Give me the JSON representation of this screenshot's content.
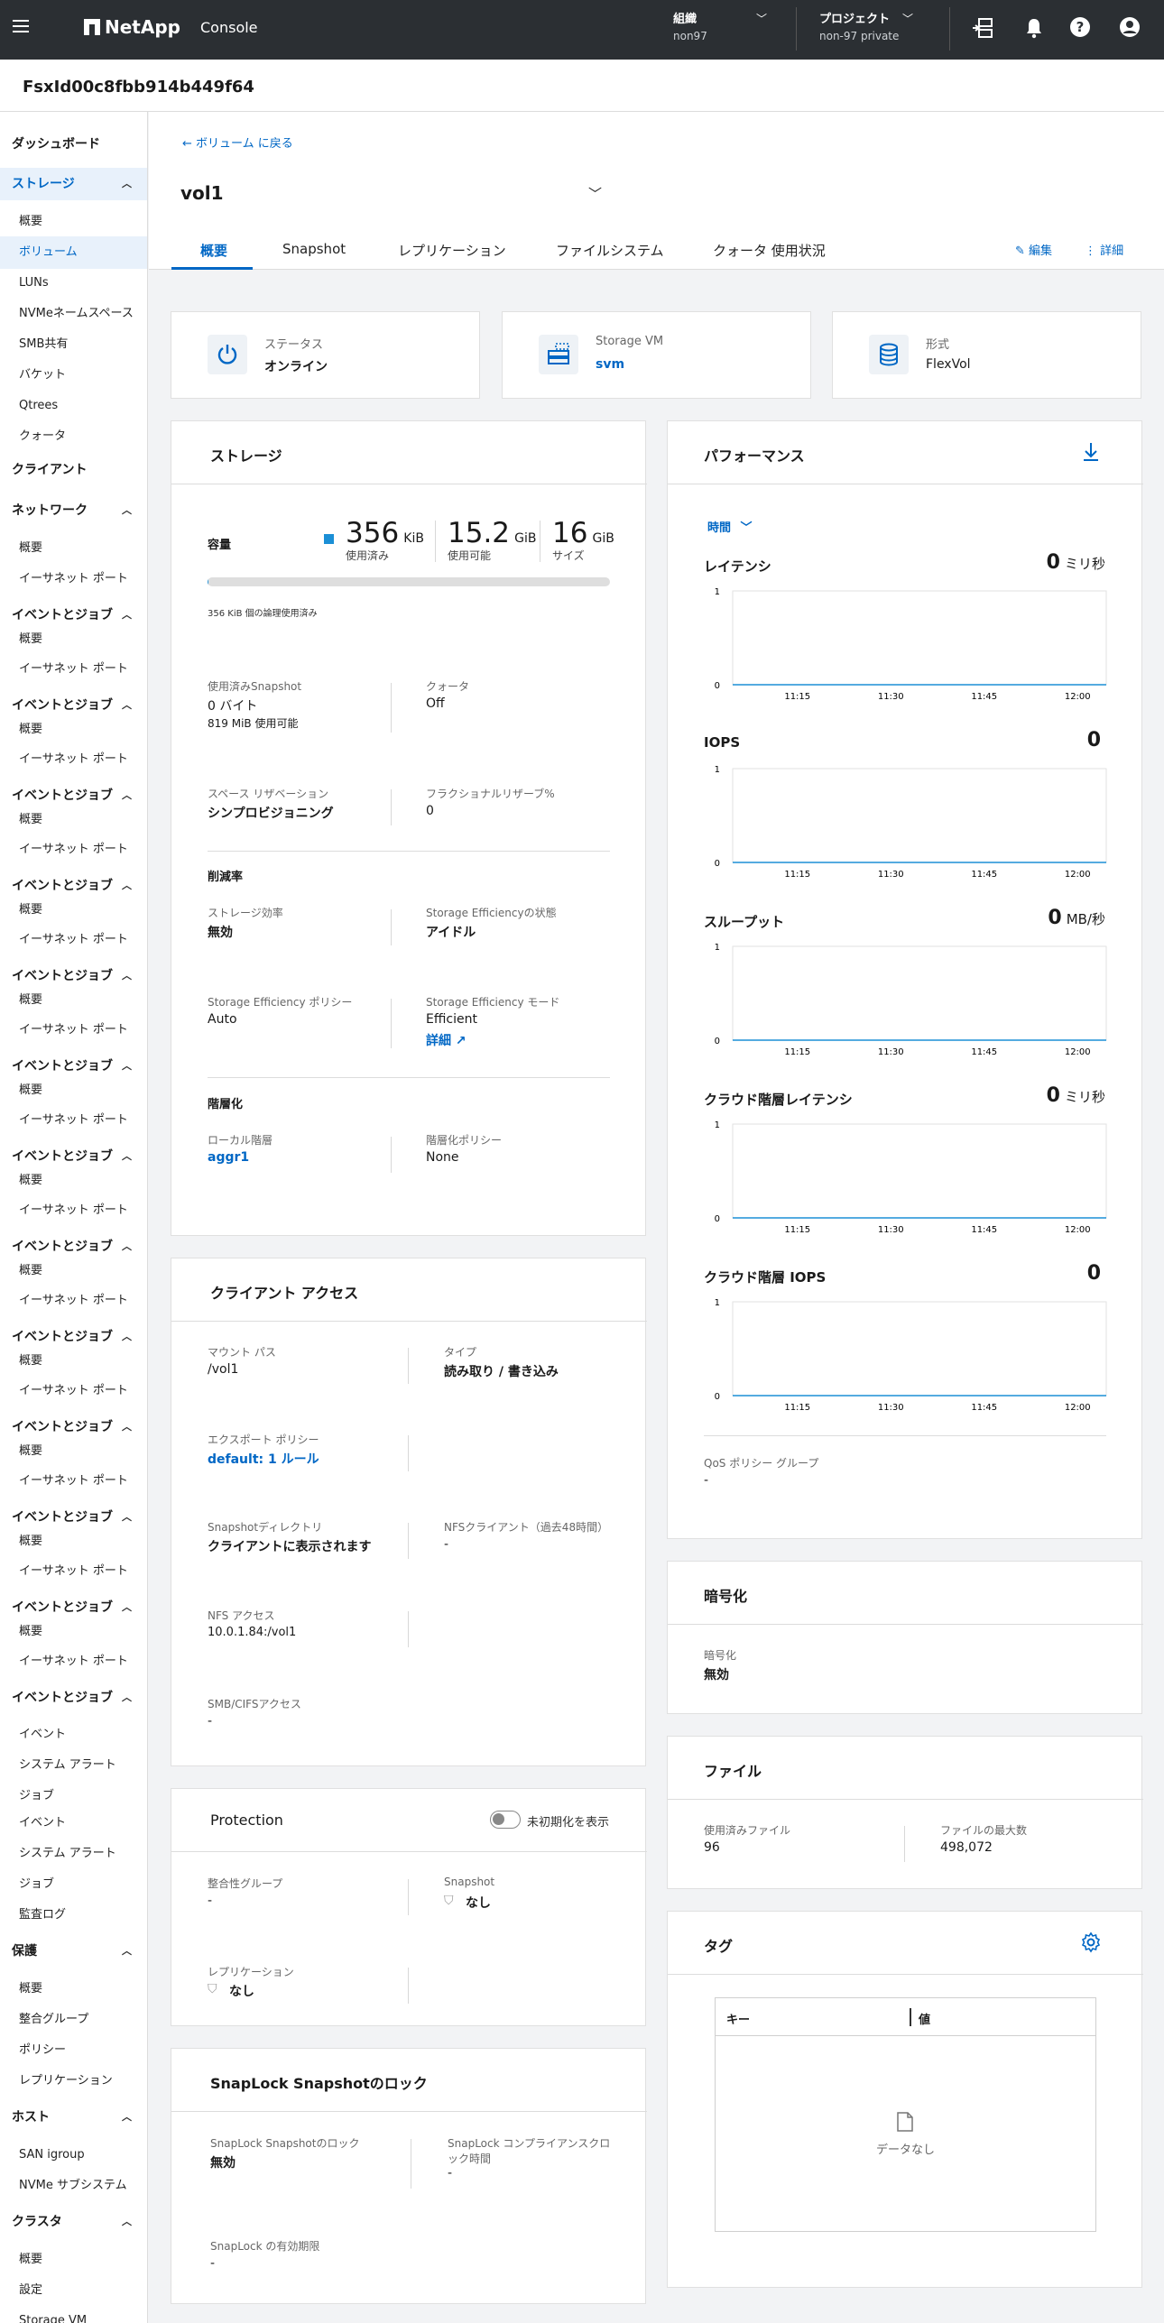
{
  "topbar": {
    "brand": "NetApp",
    "console": "Console",
    "org_label": "組織",
    "org_value": "non97",
    "project_label": "プロジェクト",
    "project_value": "non-97 private"
  },
  "fs_id": "FsxId00c8fbb914b449f64",
  "sidebar": {
    "items": [
      {
        "t": "ダッシュボード",
        "k": "h"
      },
      {
        "t": "ストレージ",
        "k": "h",
        "sel": true,
        "chev": "up"
      },
      {
        "t": "概要",
        "k": "c"
      },
      {
        "t": "ボリューム",
        "k": "c",
        "sel": true
      },
      {
        "t": "LUNs",
        "k": "c"
      },
      {
        "t": "NVMeネームスペース",
        "k": "c"
      },
      {
        "t": "SMB共有",
        "k": "c"
      },
      {
        "t": "バケット",
        "k": "c"
      },
      {
        "t": "Qtrees",
        "k": "c"
      },
      {
        "t": "クォータ",
        "k": "c"
      },
      {
        "t": "クライアント",
        "k": "h"
      },
      {
        "t": "ネットワーク",
        "k": "h",
        "chev": "up"
      },
      {
        "t": "概要",
        "k": "c"
      },
      {
        "t": "イーサネット ポート",
        "k": "c"
      },
      {
        "t": "イベントとジョブ",
        "k": "h",
        "chev": "up"
      },
      {
        "t": "概要",
        "k": "c"
      },
      {
        "t": "イーサネット ポート",
        "k": "c"
      },
      {
        "t": "イベントとジョブ",
        "k": "h",
        "chev": "up"
      },
      {
        "t": "概要",
        "k": "c"
      },
      {
        "t": "イーサネット ポート",
        "k": "c"
      },
      {
        "t": "イベントとジョブ",
        "k": "h",
        "chev": "up"
      },
      {
        "t": "概要",
        "k": "c"
      },
      {
        "t": "イーサネット ポート",
        "k": "c"
      },
      {
        "t": "イベントとジョブ",
        "k": "h",
        "chev": "up"
      },
      {
        "t": "概要",
        "k": "c"
      },
      {
        "t": "イーサネット ポート",
        "k": "c"
      },
      {
        "t": "イベントとジョブ",
        "k": "h",
        "chev": "up"
      },
      {
        "t": "概要",
        "k": "c"
      },
      {
        "t": "イーサネット ポート",
        "k": "c"
      },
      {
        "t": "イベントとジョブ",
        "k": "h",
        "chev": "up"
      },
      {
        "t": "概要",
        "k": "c"
      },
      {
        "t": "イーサネット ポート",
        "k": "c"
      },
      {
        "t": "イベントとジョブ",
        "k": "h",
        "chev": "up"
      },
      {
        "t": "概要",
        "k": "c"
      },
      {
        "t": "イーサネット ポート",
        "k": "c"
      },
      {
        "t": "イベントとジョブ",
        "k": "h",
        "chev": "up"
      },
      {
        "t": "概要",
        "k": "c"
      },
      {
        "t": "イーサネット ポート",
        "k": "c"
      },
      {
        "t": "イベントとジョブ",
        "k": "h",
        "chev": "up"
      },
      {
        "t": "概要",
        "k": "c"
      },
      {
        "t": "イーサネット ポート",
        "k": "c"
      },
      {
        "t": "イベントとジョブ",
        "k": "h",
        "chev": "up"
      },
      {
        "t": "概要",
        "k": "c"
      },
      {
        "t": "イーサネット ポート",
        "k": "c"
      },
      {
        "t": "イベントとジョブ",
        "k": "h",
        "chev": "up"
      },
      {
        "t": "概要",
        "k": "c"
      },
      {
        "t": "イーサネット ポート",
        "k": "c"
      },
      {
        "t": "イベントとジョブ",
        "k": "h",
        "chev": "up"
      },
      {
        "t": "概要",
        "k": "c"
      },
      {
        "t": "イーサネット ポート",
        "k": "c"
      },
      {
        "t": "イベントとジョブ",
        "k": "h",
        "chev": "up"
      },
      {
        "t": "イベント",
        "k": "c"
      },
      {
        "t": "システム アラート",
        "k": "c"
      },
      {
        "t": "ジョブ",
        "k": "c"
      },
      {
        "t": "イベント",
        "k": "c"
      },
      {
        "t": "システム アラート",
        "k": "c"
      },
      {
        "t": "ジョブ",
        "k": "c"
      },
      {
        "t": "監査ログ",
        "k": "c"
      },
      {
        "t": "保護",
        "k": "h",
        "chev": "up"
      },
      {
        "t": "概要",
        "k": "c"
      },
      {
        "t": "整合グループ",
        "k": "c"
      },
      {
        "t": "ポリシー",
        "k": "c"
      },
      {
        "t": "レプリケーション",
        "k": "c"
      },
      {
        "t": "ホスト",
        "k": "h",
        "chev": "up"
      },
      {
        "t": "SAN igroup",
        "k": "c"
      },
      {
        "t": "NVMe サブシステム",
        "k": "c"
      },
      {
        "t": "クラスタ",
        "k": "h",
        "chev": "up"
      },
      {
        "t": "概要",
        "k": "c"
      },
      {
        "t": "設定",
        "k": "c"
      },
      {
        "t": "Storage VM",
        "k": "c"
      }
    ]
  },
  "header": {
    "back": "← ボリューム に戻る",
    "volume": "vol1",
    "edit": "編集",
    "details": "詳細",
    "tabs": [
      "概要",
      "Snapshot",
      "レプリケーション",
      "ファイルシステム",
      "クォータ 使用状況"
    ]
  },
  "status_cards": [
    {
      "label": "ステータス",
      "value": "オンライン",
      "icon": "power-icon"
    },
    {
      "label": "Storage VM",
      "value": "svm",
      "icon": "storage-vm-icon",
      "link": true
    },
    {
      "label": "形式",
      "value": "FlexVol",
      "icon": "database-icon"
    }
  ],
  "storage": {
    "title": "ストレージ",
    "capacity_label": "容量",
    "used_num": "356",
    "used_unit": "KiB",
    "used_label": "使用済み",
    "avail_num": "15.2",
    "avail_unit": "GiB",
    "avail_label": "使用可能",
    "size_num": "16",
    "size_unit": "GiB",
    "size_label": "サイズ",
    "used_fraction": 2e-05,
    "logical_note": "356 KiB 個の論理使用済み",
    "snap_used_label": "使用済みSnapshot",
    "snap_used_value": "0 バイト",
    "snap_avail": "819 MiB  使用可能",
    "quota_label": "クォータ",
    "quota_value": "Off",
    "space_res_label": "スペース リザベーション",
    "space_res_value": "シンプロビジョニング",
    "frac_label": "フラクショナルリザーブ%",
    "frac_value": "0",
    "reduction_title": "削減率",
    "eff_label": "ストレージ効率",
    "eff_value": "無効",
    "eff_state_label": "Storage Efficiencyの状態",
    "eff_state_value": "アイドル",
    "eff_policy_label": "Storage Efficiency ポリシー",
    "eff_policy_value": "Auto",
    "eff_mode_label": "Storage Efficiency モード",
    "eff_mode_value": "Efficient",
    "eff_detail": "詳細",
    "tier_title": "階層化",
    "local_tier_label": "ローカル階層",
    "local_tier_value": "aggr1",
    "tier_policy_label": "階層化ポリシー",
    "tier_policy_value": "None"
  },
  "client": {
    "title": "クライアント アクセス",
    "mount_label": "マウント パス",
    "mount_value": "/vol1",
    "type_label": "タイプ",
    "type_value": "読み取り / 書き込み",
    "export_label": "エクスポート ポリシー",
    "export_value": "default: 1 ルール",
    "snapdir_label": "Snapshotディレクトリ",
    "snapdir_value": "クライアントに表示されます",
    "nfsclient_label": "NFSクライアント（過去48時間）",
    "nfsclient_value": "-",
    "nfs_label": "NFS アクセス",
    "nfs_value": "10.0.1.84:/vol1",
    "smb_label": "SMB/CIFSアクセス",
    "smb_value": "-"
  },
  "protection": {
    "title": "Protection",
    "toggle_label": "未初期化を表示",
    "cg_label": "整合性グループ",
    "cg_value": "-",
    "snap_label": "Snapshot",
    "snap_value": "なし",
    "rep_label": "レプリケーション",
    "rep_value": "なし"
  },
  "snaplock": {
    "title": "SnapLock Snapshotのロック",
    "lock_label": "SnapLock Snapshotのロック",
    "lock_value": "無効",
    "comp_label": "SnapLock コンプライアンスクロック時間",
    "comp_value": "-",
    "exp_label": "SnapLock の有効期限",
    "exp_value": "-"
  },
  "performance": {
    "title": "パフォーマンス",
    "range": "時間",
    "metrics": [
      {
        "name": "レイテンシ",
        "value": "0",
        "unit": "ミリ秒"
      },
      {
        "name": "IOPS",
        "value": "0",
        "unit": ""
      },
      {
        "name": "スループット",
        "value": "0",
        "unit": "MB/秒"
      },
      {
        "name": "クラウド階層レイテンシ",
        "value": "0",
        "unit": "ミリ秒"
      },
      {
        "name": "クラウド階層 IOPS",
        "value": "0",
        "unit": ""
      }
    ],
    "qos_label": "QoS ポリシー グループ",
    "qos_value": "-"
  },
  "chart_data": [
    {
      "type": "line",
      "title": "レイテンシ",
      "x": [
        "11:15",
        "11:30",
        "11:45",
        "12:00"
      ],
      "series": [
        {
          "values": [
            0,
            0,
            0,
            0
          ]
        }
      ],
      "ylim": [
        0,
        1
      ],
      "yticks": [
        "1",
        "0"
      ]
    },
    {
      "type": "line",
      "title": "IOPS",
      "x": [
        "11:15",
        "11:30",
        "11:45",
        "12:00"
      ],
      "series": [
        {
          "values": [
            0,
            0,
            0,
            0
          ]
        }
      ],
      "ylim": [
        0,
        1
      ],
      "yticks": [
        "1",
        "0"
      ]
    },
    {
      "type": "line",
      "title": "スループット",
      "x": [
        "11:15",
        "11:30",
        "11:45",
        "12:00"
      ],
      "series": [
        {
          "values": [
            0,
            0,
            0,
            0
          ]
        }
      ],
      "ylim": [
        0,
        1
      ],
      "yticks": [
        "1",
        "0"
      ]
    },
    {
      "type": "line",
      "title": "クラウド階層レイテンシ",
      "x": [
        "11:15",
        "11:30",
        "11:45",
        "12:00"
      ],
      "series": [
        {
          "values": [
            0,
            0,
            0,
            0
          ]
        }
      ],
      "ylim": [
        0,
        1
      ],
      "yticks": [
        "1",
        "0"
      ]
    },
    {
      "type": "line",
      "title": "クラウド階層 IOPS",
      "x": [
        "11:15",
        "11:30",
        "11:45",
        "12:00"
      ],
      "series": [
        {
          "values": [
            0,
            0,
            0,
            0
          ]
        }
      ],
      "ylim": [
        0,
        1
      ],
      "yticks": [
        "1",
        "0"
      ]
    }
  ],
  "encryption": {
    "title": "暗号化",
    "label": "暗号化",
    "value": "無効"
  },
  "files": {
    "title": "ファイル",
    "used_label": "使用済みファイル",
    "used_value": "96",
    "max_label": "ファイルの最大数",
    "max_value": "498,072"
  },
  "tags": {
    "title": "タグ",
    "key_col": "キー",
    "val_col": "値",
    "empty": "データなし"
  },
  "colors": {
    "accent": "#0067c5",
    "topbar": "#2b2f33",
    "chart_line": "#1b8fd6"
  }
}
